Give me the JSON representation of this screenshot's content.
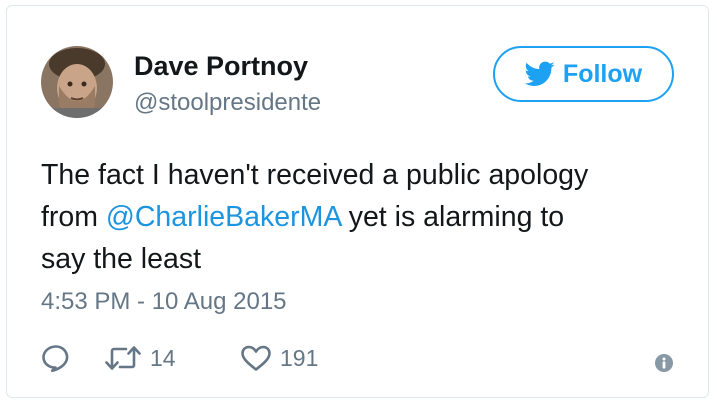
{
  "user": {
    "display_name": "Dave Portnoy",
    "handle": "@stoolpresidente"
  },
  "follow_button": {
    "label": "Follow"
  },
  "tweet": {
    "line1": "The fact I haven't received a public apology",
    "line2_pre": "from ",
    "mention": "@CharlieBakerMA",
    "line2_post": " yet is alarming to",
    "line3": "say the least",
    "timestamp": "4:53 PM - 10 Aug 2015"
  },
  "actions": {
    "reply_icon": "reply-icon",
    "retweet_icon": "retweet-icon",
    "retweet_count": "14",
    "like_icon": "heart-icon",
    "like_count": "191",
    "info_icon": "info-icon"
  },
  "colors": {
    "accent": "#1da1f2",
    "mention": "#1b95e0",
    "text": "#14171a",
    "secondary": "#657786",
    "border": "#e1e8ed"
  }
}
